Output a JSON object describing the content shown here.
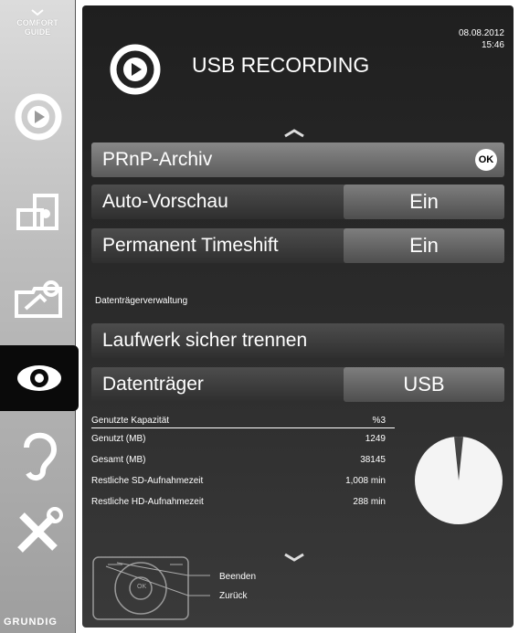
{
  "sidebar": {
    "logo_line1": "COMFORT",
    "logo_line2": "GUIDE",
    "brand": "GRUNDIG",
    "items": [
      {
        "icon": "play-icon"
      },
      {
        "icon": "screens-icon"
      },
      {
        "icon": "satellite-icon"
      },
      {
        "icon": "eye-icon",
        "active": true
      },
      {
        "icon": "ear-icon"
      },
      {
        "icon": "tools-icon"
      }
    ]
  },
  "header": {
    "date": "08.08.2012",
    "time": "15:46",
    "title": "USB RECORDING",
    "icon": "usb-recording-icon"
  },
  "menu": {
    "prnp_label": "PRnP-Archiv",
    "ok_label": "OK",
    "auto_preview_label": "Auto-Vorschau",
    "auto_preview_value": "Ein",
    "timeshift_label": "Permanent Timeshift",
    "timeshift_value": "Ein",
    "section_label": "Datenträgerverwaltung",
    "eject_label": "Laufwerk sicher trennen",
    "storage_label": "Datenträger",
    "storage_value": "USB"
  },
  "stats": {
    "used_capacity_label": "Genutzte Kapazität",
    "used_capacity_value": "%3",
    "used_label": "Genutzt (MB)",
    "used_value": "1249",
    "total_label": "Gesamt (MB)",
    "total_value": "38145",
    "sd_label": "Restliche SD-Aufnahmezeit",
    "sd_value": "1,008 min",
    "hd_label": "Restliche HD-Aufnahmezeit",
    "hd_value": "288 min",
    "used_fraction": 0.033
  },
  "footer": {
    "exit_label": "Beenden",
    "back_label": "Zurück",
    "remote_ok": "OK"
  }
}
